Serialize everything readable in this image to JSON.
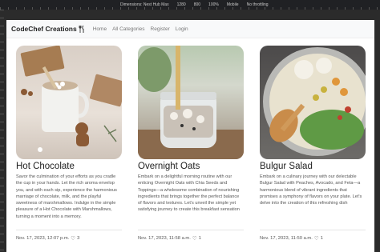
{
  "devtools": {
    "dimensions_label": "Dimensions: Nest Hub Max",
    "width": "1280",
    "height": "800",
    "zoom": "100%",
    "mode": "Mobile",
    "throttling": "No throttling"
  },
  "navbar": {
    "brand": "CodeChef Creations",
    "brand_icon": "utensils-icon",
    "links": [
      "Home",
      "All Categories",
      "Register",
      "Login"
    ]
  },
  "cards": [
    {
      "title": "Hot Chocolate",
      "image_icon": "hot-chocolate-photo",
      "text": "Savor the culmination of your efforts as you cradle the cup in your hands. Let the rich aroma envelop you, and with each sip, experience the harmonious marriage of chocolate, milk, and the playful sweetness of marshmallows. Indulge in the simple pleasure of a Hot Chocolate with Marshmallows, turning a moment into a memory.",
      "date": "Nov. 17, 2023, 12:07 p.m.",
      "likes": "3"
    },
    {
      "title": "Overnight Oats",
      "image_icon": "overnight-oats-photo",
      "text": "Embark on a delightful morning routine with our enticing Overnight Oats with Chia Seeds and Toppings—a wholesome combination of nourishing ingredients that brings together the perfect balance of flavors and textures. Let's unveil the simple yet satisfying journey to create this breakfast sensation",
      "date": "Nov. 17, 2023, 11:58 a.m.",
      "likes": "1"
    },
    {
      "title": "Bulgur Salad",
      "image_icon": "bulgur-salad-photo",
      "text": "Embark on a culinary journey with our delectable Bulgur Salad with Peaches, Avocado, and Feta—a harmonious blend of vibrant ingredients that promises a symphony of flavors on your plate. Let's delve into the creation of this refreshing dish",
      "date": "Nov. 17, 2023, 11:50 a.m.",
      "likes": "1"
    }
  ]
}
